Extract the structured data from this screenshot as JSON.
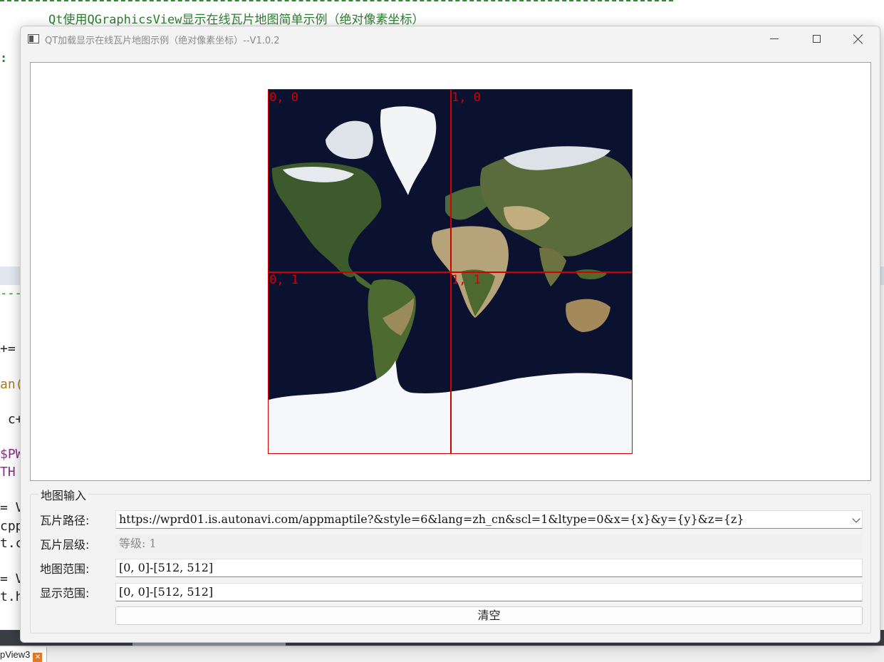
{
  "background": {
    "heading": "Qt使用QGraphicsView显示在线瓦片地图简单示例（绝对像素坐标）",
    "colon": ":",
    "dashes": "----",
    "code_lines": [
      "+=",
      "an(",
      " c+",
      "$PW",
      "TH",
      "= V",
      "cpp",
      "t.c",
      "= V",
      "t.h"
    ],
    "tab_label": "pView3"
  },
  "window": {
    "title": "QT加载显示在线瓦片地图示例（绝对像素坐标）--V1.0.2"
  },
  "map": {
    "tiles": [
      {
        "label": "0, 0"
      },
      {
        "label": "1, 0"
      },
      {
        "label": "0, 1"
      },
      {
        "label": "1, 1"
      }
    ],
    "ocean_color": "#0b1230",
    "grid_color": "#d40000"
  },
  "form": {
    "group_title": "地图输入",
    "tile_path_label": "瓦片路径:",
    "tile_path_value": "https://wprd01.is.autonavi.com/appmaptile?&style=6&lang=zh_cn&scl=1&ltype=0&x={x}&y={y}&z={z}",
    "tile_level_label": "瓦片层级:",
    "tile_level_value": "等级: 1",
    "map_range_label": "地图范围:",
    "map_range_value": "[0, 0]-[512, 512]",
    "display_range_label": "显示范围:",
    "display_range_value": "[0, 0]-[512, 512]",
    "clear_button": "清空"
  }
}
